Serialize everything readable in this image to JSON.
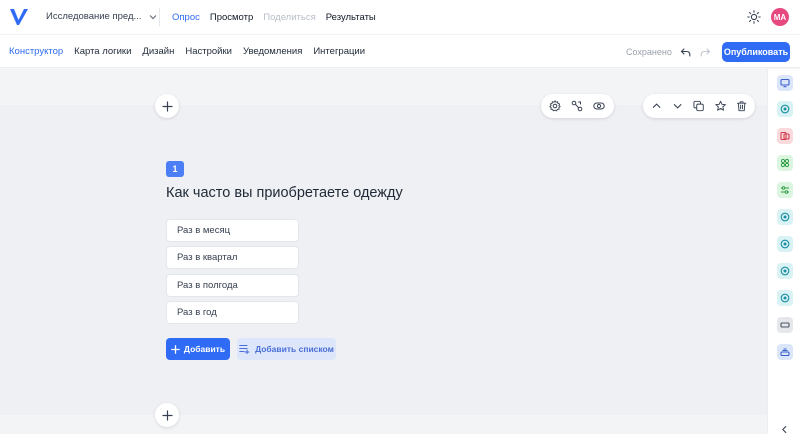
{
  "header": {
    "survey_title": "Исследование пред...",
    "nav": [
      {
        "label": "Опрос",
        "state": "active"
      },
      {
        "label": "Просмотр",
        "state": "normal"
      },
      {
        "label": "Поделиться",
        "state": "disabled"
      },
      {
        "label": "Результаты",
        "state": "normal"
      }
    ],
    "avatar_initials": "MA",
    "icons": {
      "logo": "logo-v-icon",
      "dropdown": "chevron-down-icon",
      "theme": "sun-icon"
    }
  },
  "subheader": {
    "tabs": [
      "Конструктор",
      "Карта логики",
      "Дизайн",
      "Настройки",
      "Уведомления",
      "Интеграции"
    ],
    "active_tab": "Конструктор",
    "saved_label": "Сохранено",
    "publish_label": "Опубликовать",
    "icons": {
      "undo": "undo-icon",
      "redo": "redo-icon"
    }
  },
  "question_toolbar": {
    "left_icons": [
      "gear-icon",
      "logic-icon",
      "visibility-icon"
    ],
    "right_icons": [
      "chevron-up-icon",
      "chevron-down-icon",
      "copy-icon",
      "star-icon",
      "trash-icon"
    ]
  },
  "question": {
    "number": "1",
    "title": "Как часто вы приобретаете одежду",
    "options": [
      "Раз в месяц",
      "Раз в квартал",
      "Раз в полгода",
      "Раз в год"
    ],
    "add_button": "Добавить",
    "add_list_button": "Добавить списком"
  },
  "right_panel": {
    "items": [
      {
        "icon": "screen-icon",
        "bg": "#dbe6fb",
        "fg": "#3b5fc9"
      },
      {
        "icon": "radio-icon",
        "bg": "#d9f2f4",
        "fg": "#1b8fa3"
      },
      {
        "icon": "pages-icon",
        "bg": "#fbdadd",
        "fg": "#d23a4c"
      },
      {
        "icon": "grid-icon",
        "bg": "#dcf5e0",
        "fg": "#2f9e44"
      },
      {
        "icon": "sliders-icon",
        "bg": "#dcf5e0",
        "fg": "#2f9e44"
      },
      {
        "icon": "radio-icon",
        "bg": "#d9f2f4",
        "fg": "#1b8fa3"
      },
      {
        "icon": "radio-icon",
        "bg": "#d9f2f4",
        "fg": "#1b8fa3"
      },
      {
        "icon": "radio-icon",
        "bg": "#d9f2f4",
        "fg": "#1b8fa3"
      },
      {
        "icon": "radio-icon",
        "bg": "#d9f2f4",
        "fg": "#1b8fa3"
      },
      {
        "icon": "input-box-icon",
        "bg": "#e5e7eb",
        "fg": "#4b5563"
      },
      {
        "icon": "stack-icon",
        "bg": "#dbe6fb",
        "fg": "#3b5fc9"
      }
    ],
    "collapse_icon": "chevron-left-icon"
  },
  "colors": {
    "accent": "#2f6bf5",
    "avatar": "#e64980"
  }
}
